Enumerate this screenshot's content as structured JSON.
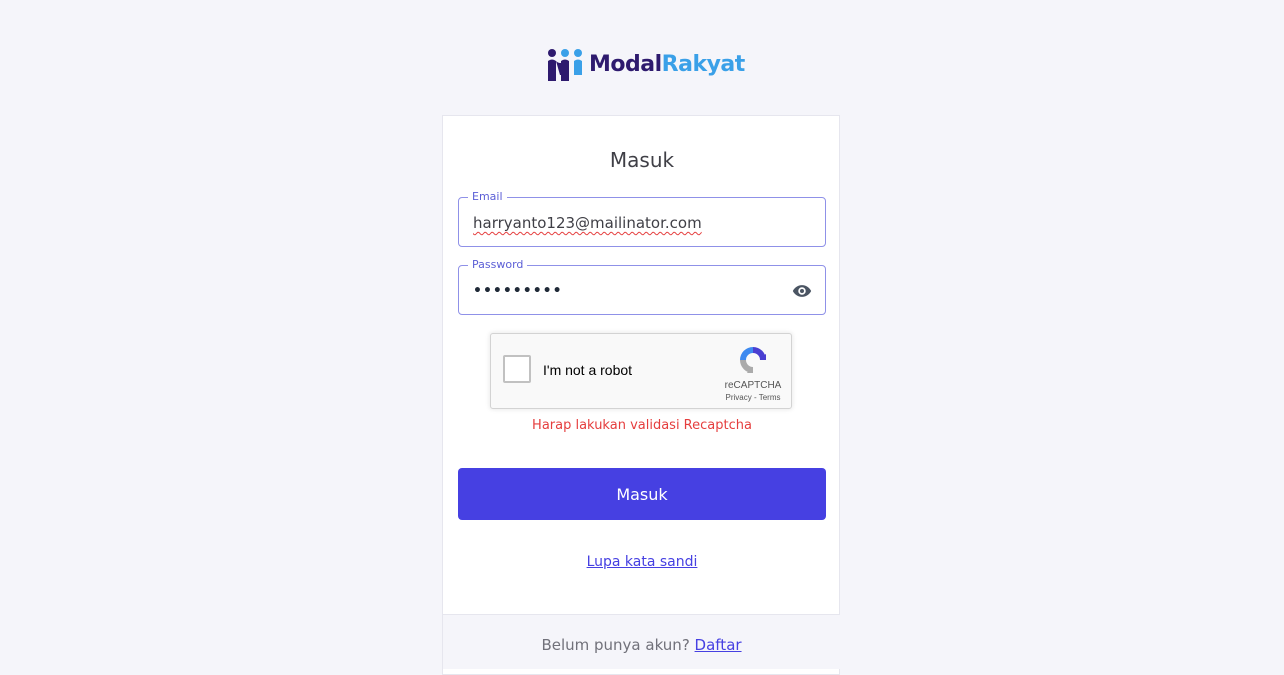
{
  "brand": {
    "name_part1": "Modal",
    "name_part2": "Rakyat"
  },
  "login": {
    "title": "Masuk",
    "email_label": "Email",
    "email_value": "harryanto123@mailinator.com",
    "password_label": "Password",
    "password_masked": "•••••••••",
    "password_toggle_icon": "eye-icon",
    "recaptcha": {
      "label": "I'm not a robot",
      "brand": "reCAPTCHA",
      "privacy": "Privacy",
      "separator": " - ",
      "terms": "Terms"
    },
    "error_message": "Harap lakukan validasi Recaptcha",
    "submit_label": "Masuk",
    "forgot_password": "Lupa kata sandi"
  },
  "footer": {
    "prompt": "Belum punya akun? ",
    "register_link": "Daftar"
  },
  "colors": {
    "primary": "#4640e2",
    "error": "#e53e3e",
    "brand_dark": "#2e1a6e",
    "brand_light": "#3aa0e8",
    "background": "#f5f5fa"
  }
}
